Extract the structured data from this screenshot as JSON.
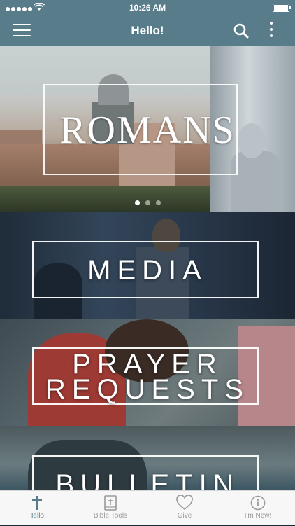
{
  "status_bar": {
    "time": "10:26 AM"
  },
  "nav": {
    "title": "Hello!"
  },
  "hero": {
    "title": "ROMANS",
    "slide_count": 3,
    "active_slide": 1
  },
  "sections": [
    {
      "label": "MEDIA"
    },
    {
      "label_line1": "PRAYER",
      "label_line2": "REQUESTS"
    },
    {
      "label": "BULLETIN"
    }
  ],
  "tabs": [
    {
      "label": "Hello!",
      "icon": "cross-icon",
      "active": true
    },
    {
      "label": "Bible Tools",
      "icon": "bible-icon",
      "active": false
    },
    {
      "label": "Give",
      "icon": "heart-icon",
      "active": false
    },
    {
      "label": "I'm New!",
      "icon": "info-icon",
      "active": false
    }
  ],
  "colors": {
    "accent": "#587c89",
    "tab_inactive": "#9a9a9a",
    "tab_bg": "#f7f7f7"
  }
}
